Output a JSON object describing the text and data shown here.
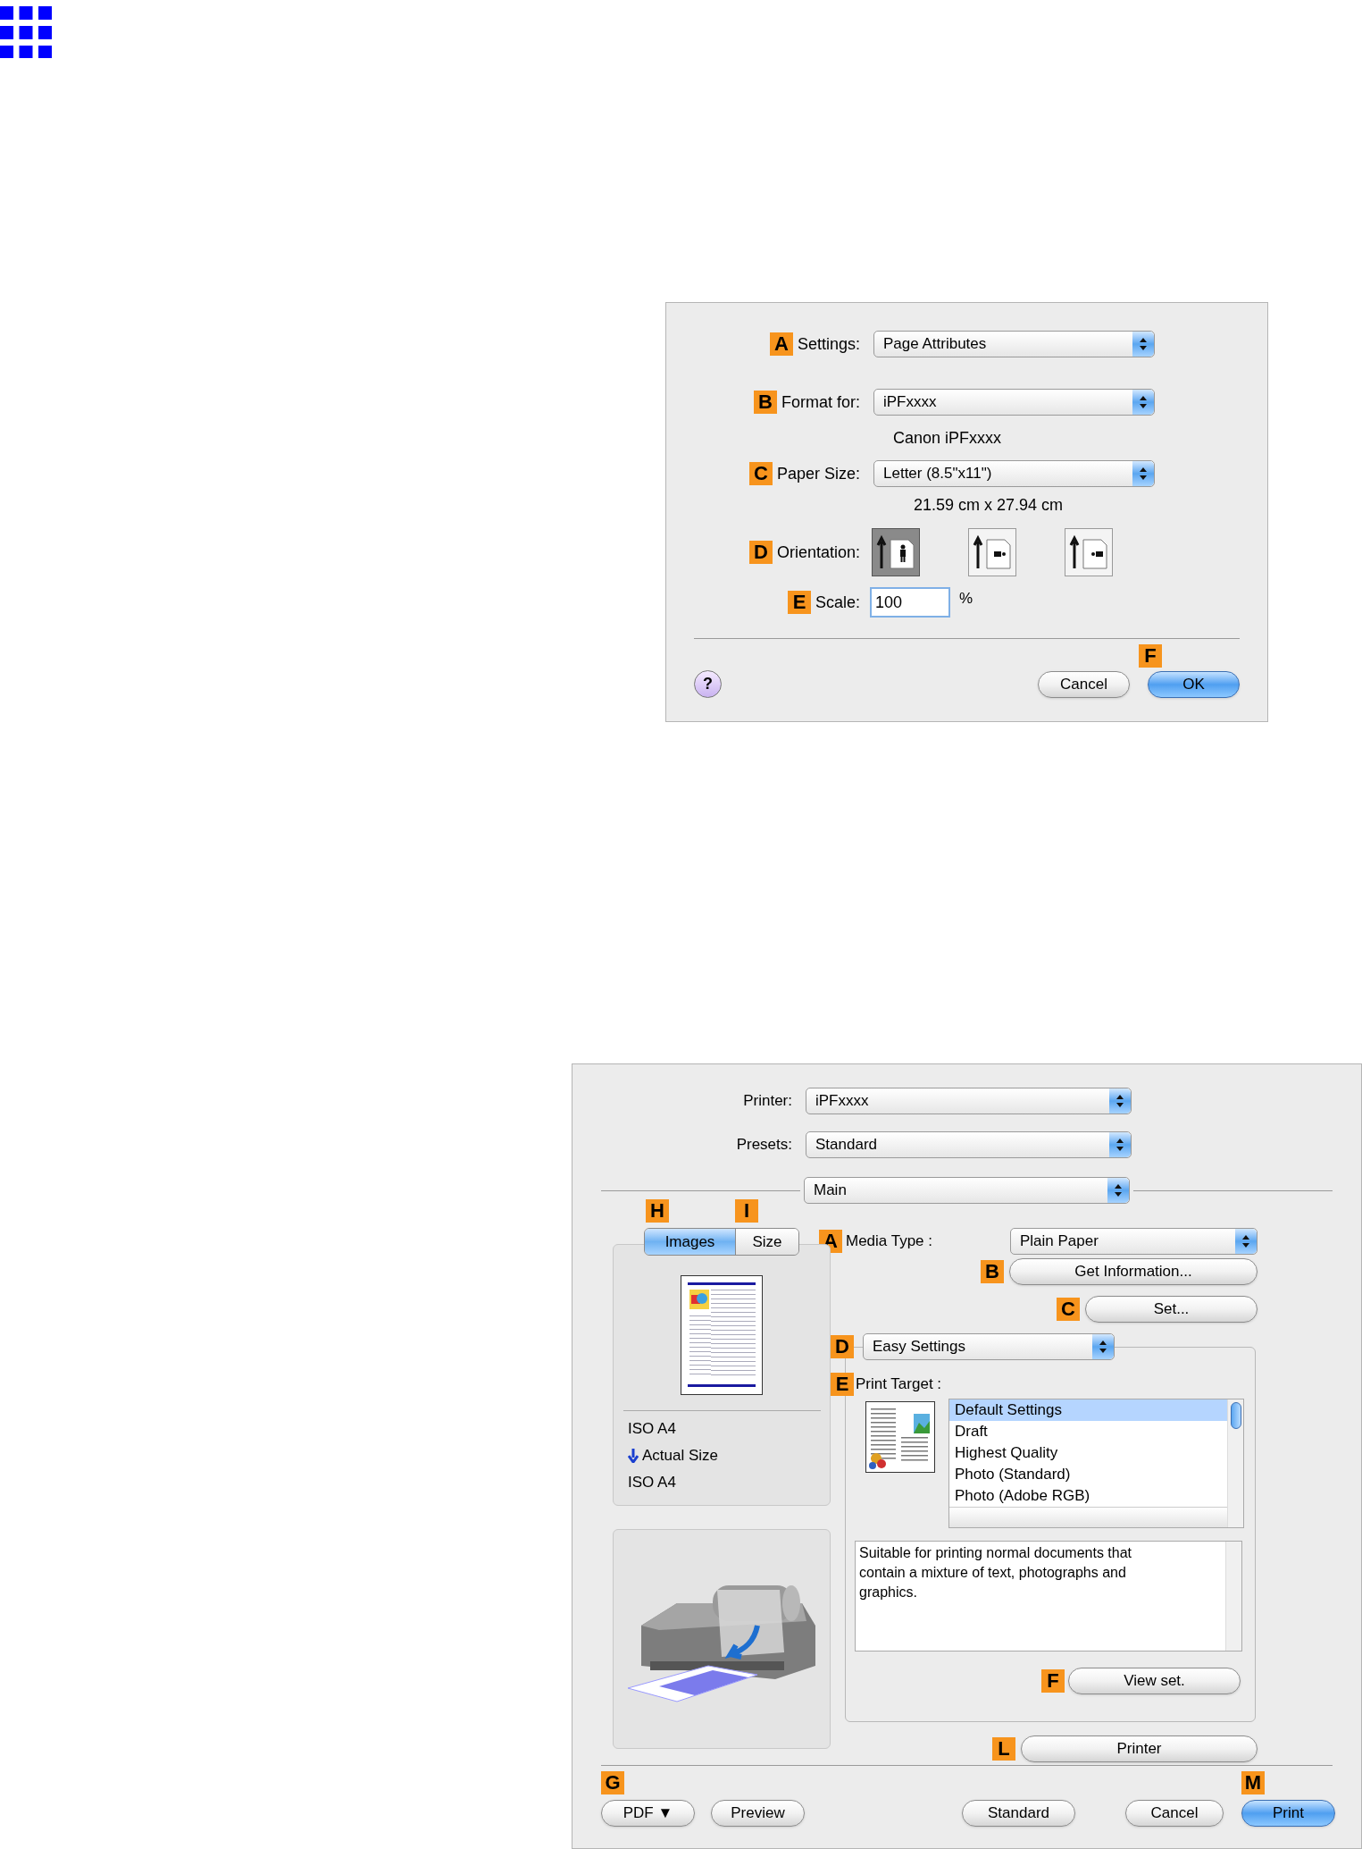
{
  "page_setup_dialog": {
    "rows": [
      {
        "kind": "popup",
        "marker": "A",
        "label": "Settings:",
        "value": "Page Attributes"
      },
      {
        "kind": "popup",
        "marker": "B",
        "label": "Format for:",
        "value": "iPFxxxx"
      },
      {
        "kind": "note",
        "text": "Canon iPFxxxx"
      },
      {
        "kind": "popup",
        "marker": "C",
        "label": "Paper Size:",
        "value": "Letter (8.5\"x11\")"
      },
      {
        "kind": "note",
        "text": "21.59 cm x 27.94 cm"
      },
      {
        "kind": "orientation",
        "marker": "D",
        "label": "Orientation:",
        "options": [
          {
            "kind": "portrait",
            "selected": true
          },
          {
            "kind": "landscape",
            "selected": false
          },
          {
            "kind": "reverse",
            "selected": false
          }
        ]
      },
      {
        "kind": "field",
        "marker": "E",
        "label": "Scale:",
        "value": "100",
        "unit": "%"
      }
    ],
    "help_button": "?",
    "buttons": [
      {
        "label": "Cancel",
        "default": false
      },
      {
        "marker": "F",
        "label": "OK",
        "default": true
      }
    ]
  },
  "print_dialog": {
    "top_rows": [
      {
        "label": "Printer:",
        "value": "iPFxxxx"
      },
      {
        "label": "Presets:",
        "value": "Standard"
      }
    ],
    "panel_popup": "Main",
    "preview_tabs": [
      {
        "marker": "H",
        "label": "Images",
        "selected": true
      },
      {
        "marker": "I",
        "label": "Size",
        "selected": false
      }
    ],
    "page_info": [
      {
        "text": "ISO A4",
        "arrow": false
      },
      {
        "text": "Actual Size",
        "arrow": true
      },
      {
        "text": "ISO A4",
        "arrow": false
      }
    ],
    "media_type": {
      "marker": "A",
      "label": "Media Type :",
      "value": "Plain Paper"
    },
    "get_information": {
      "marker": "B",
      "label": "Get Information..."
    },
    "set": {
      "marker": "C",
      "label": "Set..."
    },
    "mode": {
      "marker": "D",
      "value": "Easy Settings"
    },
    "print_target": {
      "marker": "E",
      "label": "Print Target :",
      "items": [
        {
          "label": "Default Settings",
          "selected": true
        },
        {
          "label": "Draft",
          "selected": false
        },
        {
          "label": "Highest Quality",
          "selected": false
        },
        {
          "label": "Photo (Standard)",
          "selected": false
        },
        {
          "label": "Photo (Adobe RGB)",
          "selected": false
        }
      ]
    },
    "description": "Suitable for printing normal documents that contain a mixture of text, photographs and graphics.",
    "view_set": {
      "marker": "F",
      "label": "View set."
    },
    "printer_button": {
      "marker": "L",
      "label": "Printer"
    },
    "bottom_buttons": [
      {
        "marker": "G",
        "label": "PDF ▼",
        "default": false
      },
      {
        "label": "Preview",
        "default": false
      },
      {
        "label": "Standard",
        "default": false
      },
      {
        "label": "Cancel",
        "default": false
      },
      {
        "marker": "M",
        "label": "Print",
        "default": true
      }
    ]
  }
}
